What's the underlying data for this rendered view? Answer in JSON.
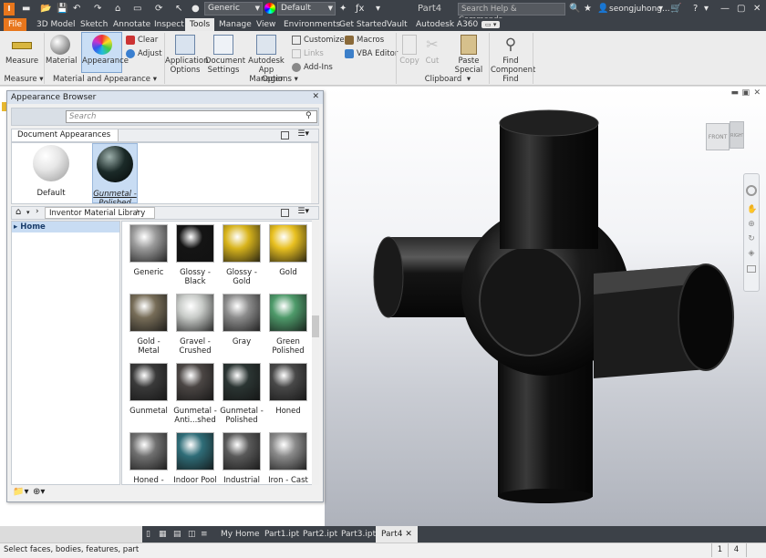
{
  "title_bar": {
    "style_combo": "Generic",
    "appearance_combo": "Default",
    "document_title": "Part4",
    "search_placeholder": "Search Help & Commands...",
    "user_name": "seongjuhong...",
    "cart_label": "",
    "help_label": ""
  },
  "menu_tabs": [
    "File",
    "3D Model",
    "Sketch",
    "Annotate",
    "Inspect",
    "Tools",
    "Manage",
    "View",
    "Environments",
    "Get Started",
    "Vault",
    "Autodesk A360"
  ],
  "active_tab": "Tools",
  "ribbon": {
    "measure": {
      "label": "Measure",
      "group": "Measure"
    },
    "material": {
      "label": "Material"
    },
    "appearance": {
      "label": "Appearance"
    },
    "clear": {
      "label": "Clear"
    },
    "adjust": {
      "label": "Adjust"
    },
    "material_group": "Material and Appearance",
    "app_options": {
      "line1": "Application",
      "line2": "Options"
    },
    "doc_settings": {
      "line1": "Document",
      "line2": "Settings"
    },
    "app_manager": {
      "line1": "Autodesk",
      "line2": "App Manager"
    },
    "customize": {
      "label": "Customize"
    },
    "links": {
      "label": "Links"
    },
    "addins": {
      "label": "Add-Ins"
    },
    "macros": {
      "label": "Macros"
    },
    "vba": {
      "label": "VBA Editor"
    },
    "options_group": "Options",
    "copy": {
      "label": "Copy"
    },
    "cut": {
      "label": "Cut"
    },
    "paste_special": {
      "line1": "Paste",
      "line2": "Special"
    },
    "clipboard_group": "Clipboard",
    "find_component": {
      "line1": "Find",
      "line2": "Component"
    },
    "find_group": "Find"
  },
  "appearance_browser": {
    "title": "Appearance Browser",
    "search_placeholder": "Search",
    "doc_appearances_label": "Document Appearances",
    "doc_items": [
      {
        "name": "Default",
        "color": "#e6e6e6"
      },
      {
        "name": "Gunmetal - Polished",
        "color": "#1b2a28"
      }
    ],
    "library_label": "Inventor Material Library",
    "tree_home": "Home",
    "library_items": [
      {
        "name": "Generic",
        "color": "#9a9a9a"
      },
      {
        "name": "Glossy - Black",
        "color": "#141414"
      },
      {
        "name": "Glossy - Gold",
        "color": "#d8b41c"
      },
      {
        "name": "Gold",
        "color": "#e8c020"
      },
      {
        "name": "Gold - Metal",
        "color": "#776d58"
      },
      {
        "name": "Gravel - Crushed",
        "color": "#c8cbc8"
      },
      {
        "name": "Gray",
        "color": "#8c8c8c"
      },
      {
        "name": "Green Polished",
        "color": "#4e9a6a"
      },
      {
        "name": "Gunmetal",
        "color": "#3a3a3a"
      },
      {
        "name": "Gunmetal - Anti...shed",
        "color": "#4b4644"
      },
      {
        "name": "Gunmetal - Polished",
        "color": "#2b3533"
      },
      {
        "name": "Honed",
        "color": "#484848"
      },
      {
        "name": "Honed -",
        "color": "#707070"
      },
      {
        "name": "Indoor Pool",
        "color": "#2f6d78"
      },
      {
        "name": "Industrial",
        "color": "#5a5a5a"
      },
      {
        "name": "Iron - Cast",
        "color": "#8a8a8a"
      }
    ]
  },
  "view_cube": {
    "front": "FRONT",
    "right": "RIGHT"
  },
  "document_tabs": [
    "My Home",
    "Part1.ipt",
    "Part2.ipt",
    "Part3.ipt",
    "Part4"
  ],
  "active_document": "Part4",
  "status": {
    "message": "Select faces, bodies, features, part",
    "count1": "1",
    "count2": "4"
  }
}
